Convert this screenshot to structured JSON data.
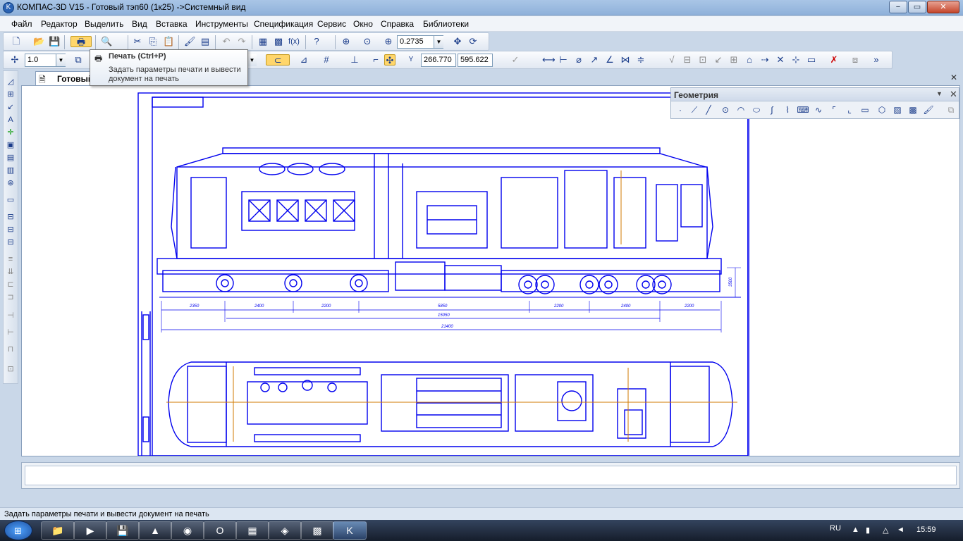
{
  "window": {
    "title": "КОМПАС-3D V15 - Готовый  тэп60 (1к25) ->Системный вид",
    "minimize": "−",
    "maximize": "▭",
    "close": "✕"
  },
  "menu": [
    "Файл",
    "Редактор",
    "Выделить",
    "Вид",
    "Вставка",
    "Инструменты",
    "Спецификация",
    "Сервис",
    "Окно",
    "Справка",
    "Библиотеки"
  ],
  "toolbar": {
    "zoom_value": "0.2735",
    "line_scale": "1.0",
    "coord_x": "266.770",
    "coord_y": "595.622"
  },
  "tooltip": {
    "title": "Печать (Ctrl+P)",
    "body": "Задать параметры печати и вывести документ на печать"
  },
  "document": {
    "tab_label": "Готовый",
    "close": "✕"
  },
  "geometry_panel": {
    "title": "Геометрия",
    "menu": "▼",
    "close": "✕"
  },
  "drawing": {
    "dimensions_top": [
      "2350",
      "2400",
      "2200",
      "5850",
      "2200",
      "2400",
      "2200"
    ],
    "dimension_mid": "15050",
    "dimension_bottom": "21400",
    "height_dim": "3500"
  },
  "status": {
    "text": "Задать параметры печати и вывести документ на печать"
  },
  "taskbar": {
    "language": "RU",
    "clock": "15:59"
  },
  "colors": {
    "drawing_line": "#0000ee",
    "drawing_accent": "#d07a00",
    "canvas_bg": "#ffffff"
  }
}
